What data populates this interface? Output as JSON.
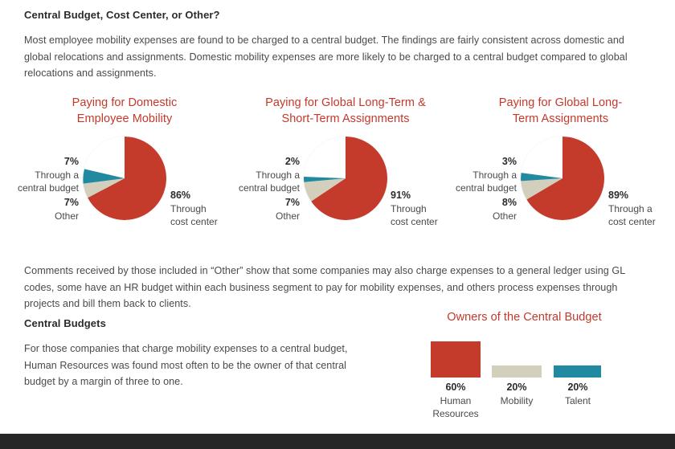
{
  "page": {
    "heading": "Central Budget, Cost Center, or Other?",
    "intro_paragraph": "Most employee mobility expenses are found to be charged to a central budget. The findings are fairly consistent across domestic and global relocations and assignments. Domestic mobility expenses are more likely to be charged to a central budget compared to global relocations and assignments.",
    "comments_paragraph": "Comments received by those included in “Other” show that some companies may also charge expenses to a general ledger using GL codes, some have an HR budget within each business segment to pay for mobility expenses, and others process expenses through projects and bill them back to clients.",
    "subheading": "Central Budgets",
    "central_budget_paragraph": "For those companies that charge mobility expenses to a central budget, Human Resources was found most often to be the owner of that central budget by a margin of three to one."
  },
  "colors": {
    "red": "#c43a2b",
    "beige": "#d3cfbd",
    "teal": "#2189a0",
    "title_red": "#c4392c",
    "body_text": "#4a4a4a",
    "heading_text": "#2b2b2b",
    "footer": "#262626",
    "background": "#ffffff"
  },
  "chart_data": [
    {
      "type": "pie",
      "id": "domestic-employee-mobility",
      "title": "Paying for Domestic Employee Mobility",
      "title_lines": [
        "Paying for Domestic",
        "Employee Mobility"
      ],
      "categories": [
        "Through cost center",
        "Through a central budget",
        "Other"
      ],
      "values": [
        86,
        7,
        7
      ],
      "unit": "%",
      "colors": [
        "#c43a2b",
        "#2189a0",
        "#d3cfbd"
      ],
      "labels": [
        {
          "pct": "86%",
          "line1": "Through",
          "line2": "cost center",
          "side": "right",
          "color": "#c43a2b"
        },
        {
          "pct": "7%",
          "line1": "Through a",
          "line2": "central budget",
          "side": "left",
          "color": "#2189a0"
        },
        {
          "pct": "7%",
          "line1": "Other",
          "line2": "",
          "side": "left",
          "color": "#d3cfbd"
        }
      ]
    },
    {
      "type": "pie",
      "id": "global-long-and-short-term-assignments",
      "title": "Paying for Global Long-Term & Short-Term Assignments",
      "title_lines": [
        "Paying for Global Long-Term &",
        "Short-Term Assignments"
      ],
      "categories": [
        "Through cost center",
        "Through a central budget",
        "Other"
      ],
      "values": [
        91,
        2,
        7
      ],
      "unit": "%",
      "colors": [
        "#c43a2b",
        "#2189a0",
        "#d3cfbd"
      ],
      "labels": [
        {
          "pct": "91%",
          "line1": "Through",
          "line2": "cost center",
          "side": "right",
          "color": "#c43a2b"
        },
        {
          "pct": "2%",
          "line1": "Through a",
          "line2": "central budget",
          "side": "left",
          "color": "#2189a0"
        },
        {
          "pct": "7%",
          "line1": "Other",
          "line2": "",
          "side": "left",
          "color": "#d3cfbd"
        }
      ]
    },
    {
      "type": "pie",
      "id": "global-long-term-assignments",
      "title": "Paying for Global Long-Term Assignments",
      "title_lines": [
        "Paying for Global Long-",
        "Term Assignments"
      ],
      "categories": [
        "Through a cost center",
        "Through a central budget",
        "Other"
      ],
      "values": [
        89,
        3,
        8
      ],
      "unit": "%",
      "colors": [
        "#c43a2b",
        "#2189a0",
        "#d3cfbd"
      ],
      "labels": [
        {
          "pct": "89%",
          "line1": "Through a",
          "line2": "cost center",
          "side": "right",
          "color": "#c43a2b"
        },
        {
          "pct": "3%",
          "line1": "Through a",
          "line2": "central budget",
          "side": "left",
          "color": "#2189a0"
        },
        {
          "pct": "8%",
          "line1": "Other",
          "line2": "",
          "side": "left",
          "color": "#d3cfbd"
        }
      ]
    },
    {
      "type": "bar",
      "id": "owners-of-the-central-budget",
      "title": "Owners of the Central Budget",
      "categories": [
        "Human Resources",
        "Mobility",
        "Talent"
      ],
      "values": [
        60,
        20,
        20
      ],
      "unit": "%",
      "ylim": [
        0,
        60
      ],
      "grid": false,
      "legend": "none",
      "xlabel": "",
      "ylabel": "",
      "colors": [
        "#c43a2b",
        "#d3cfbd",
        "#2189a0"
      ],
      "bars": [
        {
          "pct": "60%",
          "line1": "Human",
          "line2": "Resources",
          "value": 60,
          "color": "#c43a2b"
        },
        {
          "pct": "20%",
          "line1": "Mobility",
          "line2": "",
          "value": 20,
          "color": "#d3cfbd"
        },
        {
          "pct": "20%",
          "line1": "Talent",
          "line2": "",
          "value": 20,
          "color": "#2189a0"
        }
      ]
    }
  ]
}
